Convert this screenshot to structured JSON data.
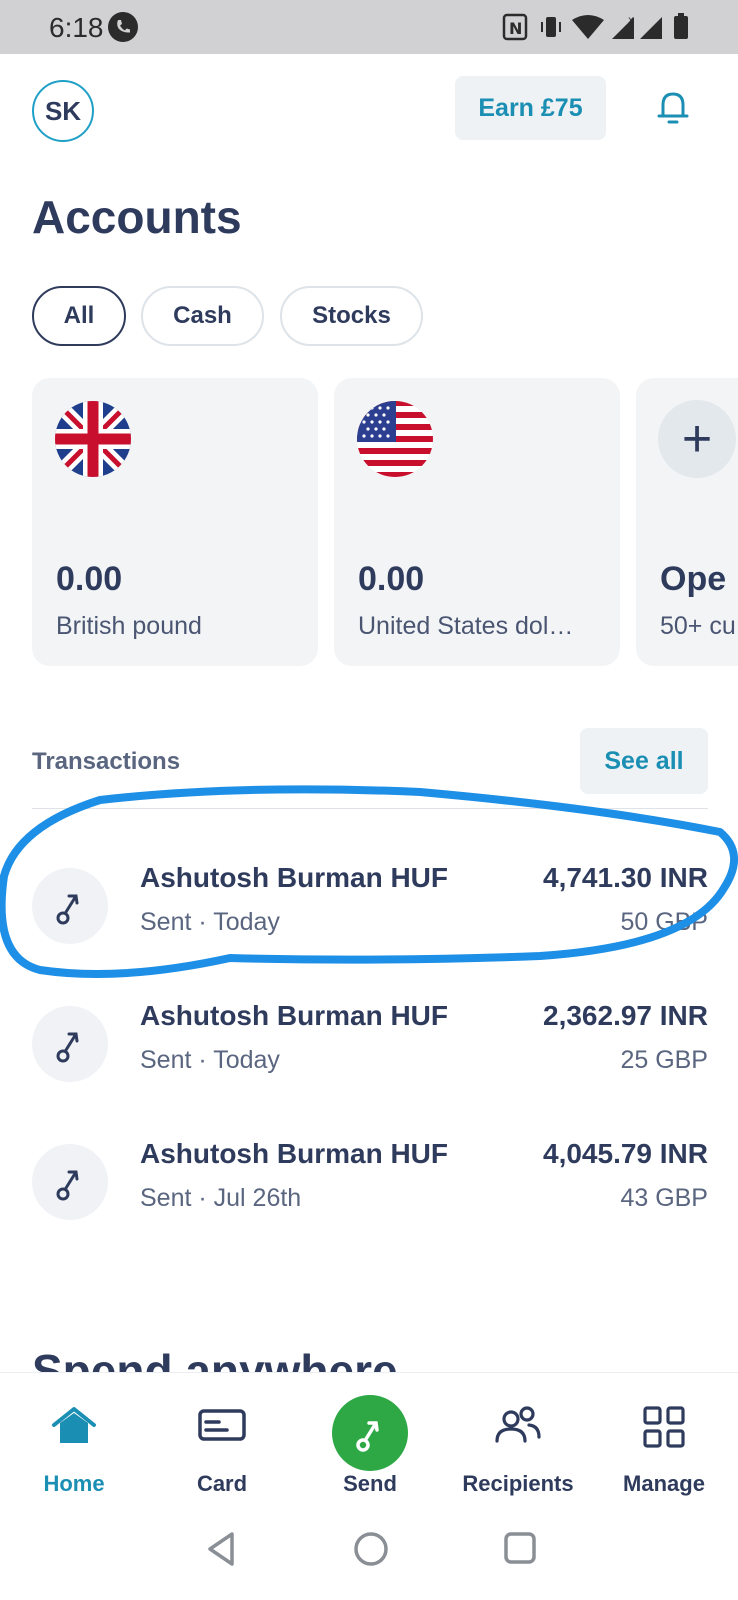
{
  "status_bar": {
    "time": "6:18"
  },
  "header": {
    "avatar_initials": "SK",
    "earn_label": "Earn £75"
  },
  "page_title": "Accounts",
  "filters": [
    {
      "label": "All",
      "selected": true
    },
    {
      "label": "Cash"
    },
    {
      "label": "Stocks"
    }
  ],
  "accounts": [
    {
      "amount": "0.00",
      "name": "British pound",
      "flag": "uk-flag"
    },
    {
      "amount": "0.00",
      "name": "United States dol…",
      "flag": "us-flag"
    },
    {
      "amount": "Ope",
      "name": "50+ cu",
      "icon": "plus-icon"
    }
  ],
  "transactions_section": {
    "label": "Transactions",
    "see_all": "See all"
  },
  "transactions": [
    {
      "name": "Ashutosh Burman HUF",
      "status": "Sent · Today",
      "amount": "4,741.30 INR",
      "secondary": "50 GBP"
    },
    {
      "name": "Ashutosh Burman HUF",
      "status": "Sent · Today",
      "amount": "2,362.97 INR",
      "secondary": "25 GBP"
    },
    {
      "name": "Ashutosh Burman HUF",
      "status": "Sent · Jul 26th",
      "amount": "4,045.79 INR",
      "secondary": "43 GBP"
    }
  ],
  "next_section_heading": "Spend anywhere",
  "bottom_nav": [
    {
      "label": "Home",
      "icon": "home-icon",
      "active": true
    },
    {
      "label": "Card",
      "icon": "card-icon"
    },
    {
      "label": "Send",
      "icon": "send-icon"
    },
    {
      "label": "Recipients",
      "icon": "recipients-icon"
    },
    {
      "label": "Manage",
      "icon": "grid-icon"
    }
  ],
  "colors": {
    "accent": "#1b8fb3",
    "text": "#2f3b5c",
    "send_green": "#2ea844",
    "annotation_blue": "#1e8fe6"
  }
}
